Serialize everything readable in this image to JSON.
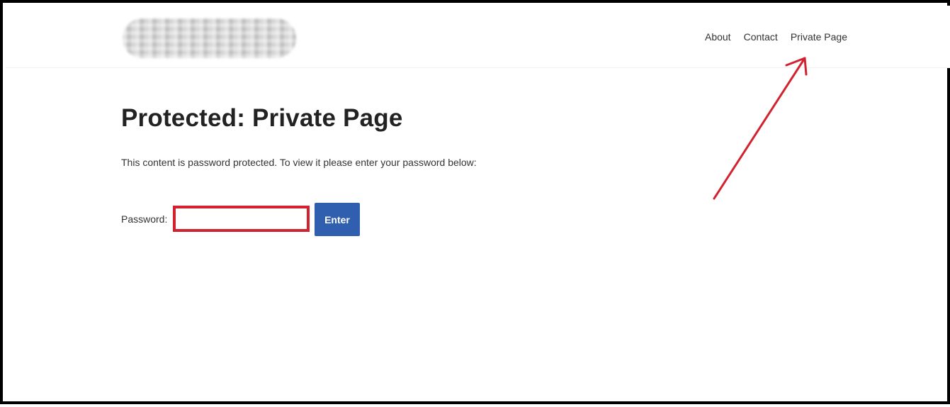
{
  "header": {
    "logo_alt": "",
    "nav": {
      "about": "About",
      "contact": "Contact",
      "private_page": "Private Page"
    }
  },
  "main": {
    "title": "Protected: Private Page",
    "intro": "This content is password protected. To view it please enter your password below:",
    "password_label": "Password:",
    "password_value": "",
    "enter_label": "Enter"
  },
  "colors": {
    "frame": "#000000",
    "button": "#2f5fae",
    "highlight": "#d3222f"
  },
  "icons": {
    "annotation": "red-arrow-icon"
  }
}
